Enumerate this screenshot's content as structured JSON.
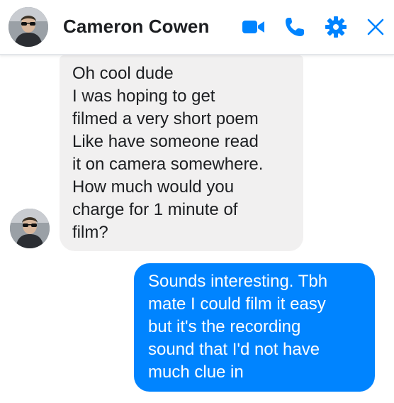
{
  "header": {
    "contact_name": "Cameron Cowen",
    "icons": [
      "video-camera-icon",
      "phone-icon",
      "gear-icon",
      "close-icon"
    ],
    "accent_color": "#0084ff"
  },
  "messages": [
    {
      "direction": "incoming",
      "lines": [
        "Oh cool dude",
        "I was hoping to get",
        "filmed a very short poem",
        "Like have someone read",
        "it on camera somewhere.",
        "How much would you",
        "charge for 1 minute of",
        "film?"
      ],
      "bubble_color": "#f1f0f0"
    },
    {
      "direction": "outgoing",
      "lines": [
        "Sounds interesting. Tbh",
        "mate I could film it easy",
        "but it's the recording",
        "sound that I'd not have",
        "much clue in"
      ],
      "bubble_color": "#0084ff"
    }
  ]
}
